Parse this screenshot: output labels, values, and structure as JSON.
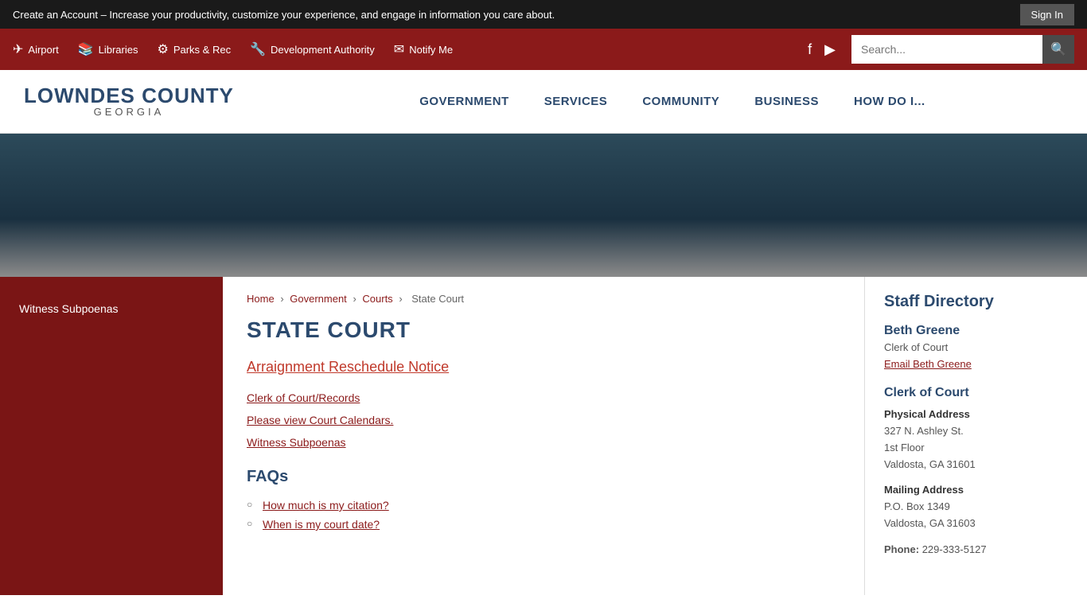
{
  "top_banner": {
    "text": "Create an Account – Increase your productivity, customize your experience, and engage in information you care about.",
    "sign_in_label": "Sign In"
  },
  "utility_nav": {
    "links": [
      {
        "label": "Airport",
        "icon": "✈"
      },
      {
        "label": "Libraries",
        "icon": "📚"
      },
      {
        "label": "Parks & Rec",
        "icon": "⚙"
      },
      {
        "label": "Development Authority",
        "icon": "🔧"
      },
      {
        "label": "Notify Me",
        "icon": "✉"
      }
    ],
    "search_placeholder": "Search..."
  },
  "header": {
    "logo_title": "LOWNDES COUNTY",
    "logo_subtitle": "GEORGIA",
    "nav_items": [
      {
        "label": "GOVERNMENT"
      },
      {
        "label": "SERVICES"
      },
      {
        "label": "COMMUNITY"
      },
      {
        "label": "BUSINESS"
      },
      {
        "label": "HOW DO I..."
      }
    ]
  },
  "sidebar": {
    "items": [
      {
        "label": "Witness Subpoenas"
      }
    ]
  },
  "breadcrumb": {
    "home": "Home",
    "government": "Government",
    "courts": "Courts",
    "current": "State Court"
  },
  "main": {
    "page_title": "STATE COURT",
    "primary_link": "Arraignment Reschedule Notice",
    "links": [
      {
        "label": "Clerk of Court/Records"
      },
      {
        "label": "Please view Court Calendars."
      },
      {
        "label": "Witness Subpoenas"
      }
    ],
    "faqs_title": "FAQs",
    "faq_items": [
      {
        "label": "How much is my citation?"
      },
      {
        "label": "When is my court date?"
      }
    ]
  },
  "staff_directory": {
    "title": "Staff Directory",
    "person": {
      "name": "Beth Greene",
      "role": "Clerk of Court",
      "email_label": "Email Beth Greene"
    },
    "clerk_section": {
      "title": "Clerk of Court",
      "physical_address_label": "Physical Address",
      "physical_address": "327 N. Ashley St.\n1st Floor\nValdosta, GA 31601",
      "mailing_address_label": "Mailing Address",
      "mailing_address": "P.O. Box 1349\nValdosta, GA 31603",
      "phone_label": "Phone:",
      "phone": "229-333-5127"
    }
  }
}
